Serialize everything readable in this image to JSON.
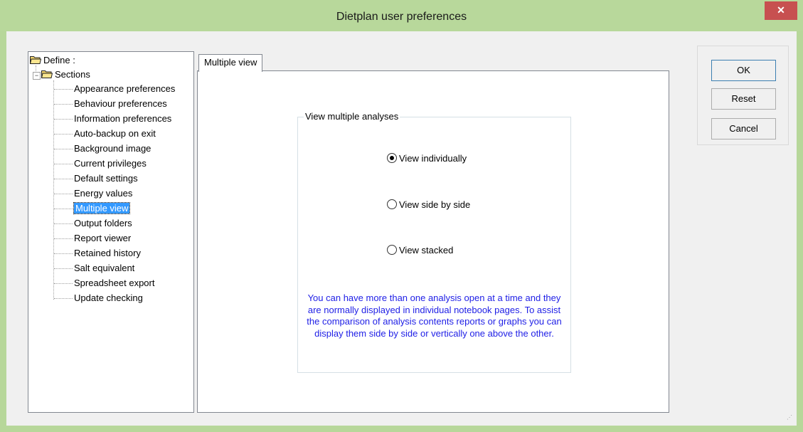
{
  "window": {
    "title": "Dietplan user preferences",
    "close_glyph": "✕"
  },
  "tree": {
    "root_label": "Define :",
    "sections_label": "Sections",
    "expander_glyph": "−",
    "items": [
      "Appearance preferences",
      "Behaviour preferences",
      "Information preferences",
      "Auto-backup on exit",
      "Background image",
      "Current privileges",
      "Default settings",
      "Energy values",
      "Multiple view",
      "Output folders",
      "Report viewer",
      "Retained history",
      "Salt equivalent",
      "Spreadsheet export",
      "Update checking"
    ],
    "selected_index": 8
  },
  "tab": {
    "label": "Multiple view",
    "group_label": "View multiple analyses",
    "options": [
      "View individually",
      "View side by side",
      "View stacked"
    ],
    "selected_option": 0,
    "info_text": "You can have more than one analysis open at a time and they are normally displayed in individual notebook pages. To assist the comparison of analysis contents reports or graphs you can display them side by side or vertically one above the other."
  },
  "buttons": {
    "ok": "OK",
    "reset": "Reset",
    "cancel": "Cancel"
  },
  "colors": {
    "frame": "#b8d89b",
    "accent_selected": "#3399ff",
    "info_text": "#1e1ee6",
    "close": "#c75050"
  }
}
